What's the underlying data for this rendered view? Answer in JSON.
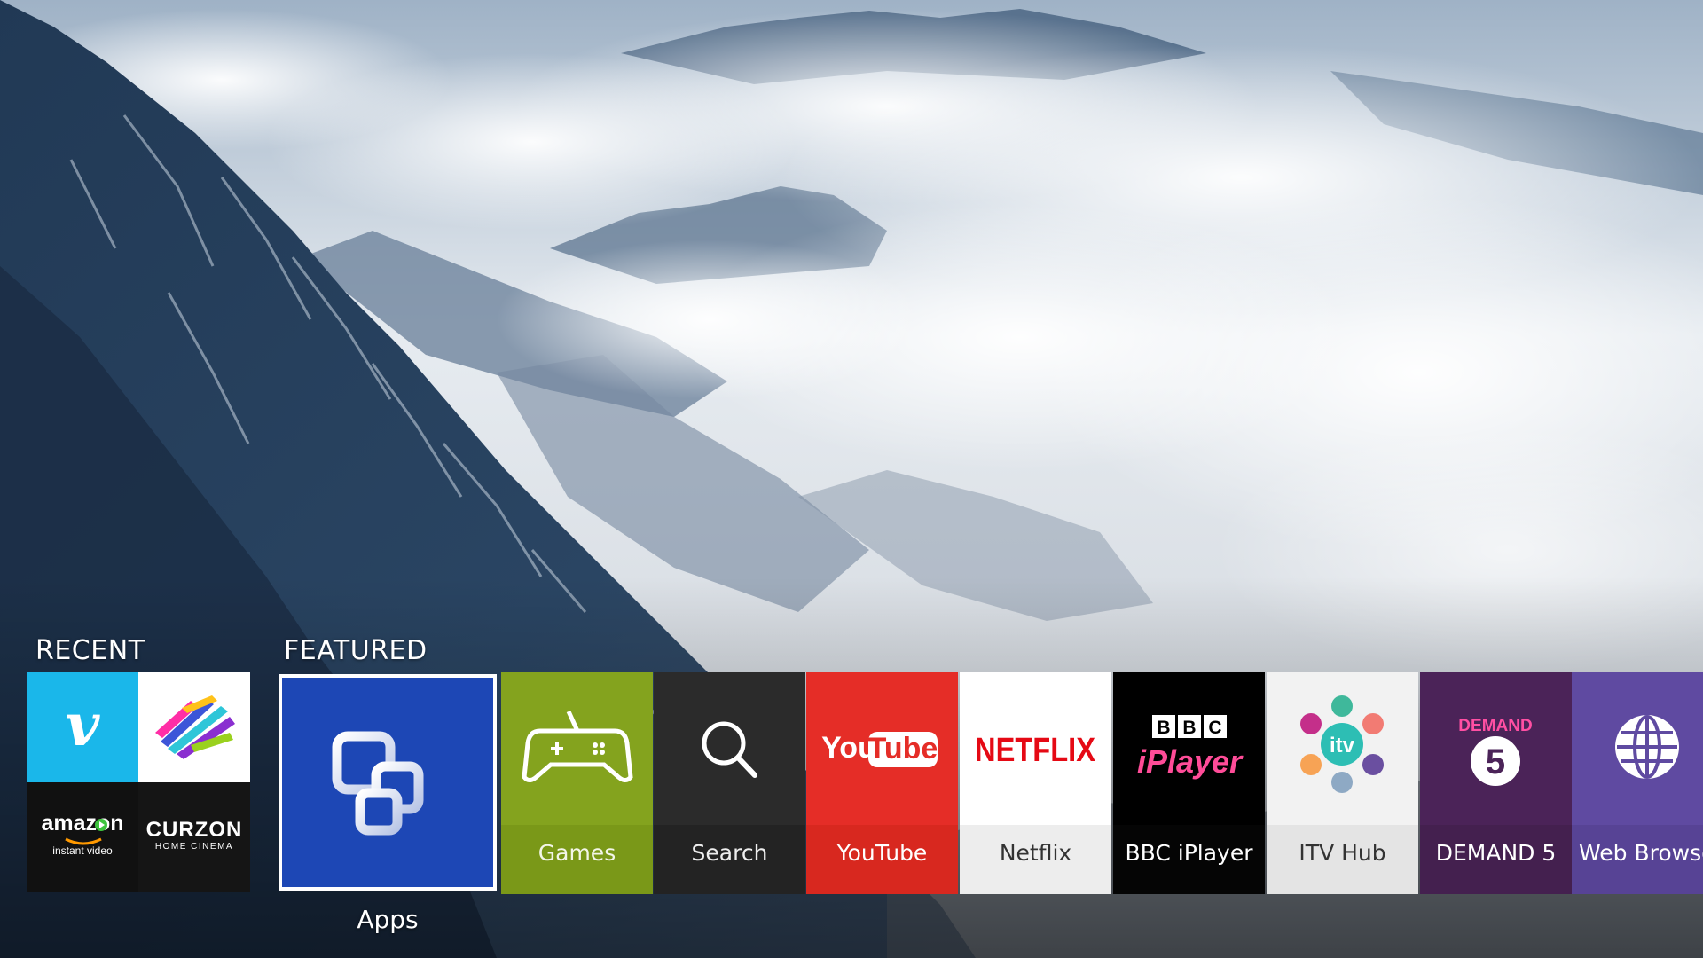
{
  "recent": {
    "label": "RECENT",
    "apps": [
      {
        "name": "vimeo",
        "glyph": "v",
        "color": "#1ab7ea"
      },
      {
        "name": "channel-4",
        "color": "#ffffff"
      },
      {
        "name": "amazon-instant-video",
        "word": "amazon",
        "sub": "instant video",
        "color": "#111111"
      },
      {
        "name": "curzon-home-cinema",
        "word": "CURZON",
        "sub": "HOME CINEMA",
        "color": "#151515"
      }
    ]
  },
  "featured": {
    "label": "FEATURED",
    "selected_app": "Apps",
    "apps_label": "Apps",
    "tiles": [
      {
        "label": "Games",
        "icon": "gamepad-icon",
        "color": "#84a31e"
      },
      {
        "label": "Search",
        "icon": "magnifier-icon",
        "color": "#2b2b2b"
      },
      {
        "label": "YouTube",
        "icon": "youtube-logo",
        "color": "#e52d27"
      },
      {
        "label": "Netflix",
        "icon": "netflix-logo",
        "color": "#ffffff"
      },
      {
        "label": "BBC iPlayer",
        "icon": "bbc-iplayer-logo",
        "color": "#000000"
      },
      {
        "label": "ITV Hub",
        "icon": "itv-hub-logo",
        "color": "#f2f2f2"
      },
      {
        "label": "DEMAND 5",
        "icon": "demand5-logo",
        "color": "#4b2358"
      },
      {
        "label": "Web Browser",
        "icon": "globe-icon",
        "color": "#5f4aa1"
      }
    ]
  },
  "logos": {
    "youtube_you": "You",
    "youtube_tube": "Tube",
    "netflix": "NETFLIX",
    "bbc_letters": [
      "B",
      "B",
      "C"
    ],
    "iplayer": "iPlayer",
    "itv": "itv",
    "demand": "DEMAND",
    "five": "5"
  },
  "colors": {
    "apps_blue": "#1d47b5",
    "selection_border": "#ffffff",
    "netflix_red": "#e50914",
    "iplayer_pink": "#ff4c98"
  }
}
